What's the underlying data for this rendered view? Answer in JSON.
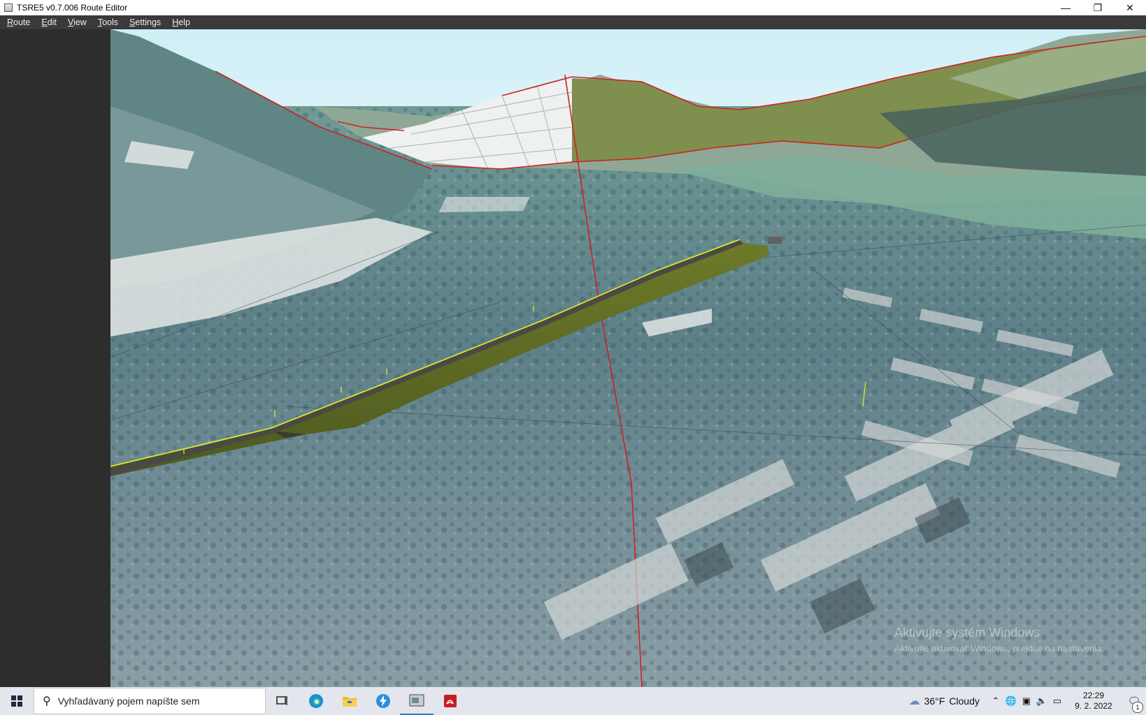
{
  "window": {
    "title": "TSRE5 v0.7.006 Route Editor",
    "minimize_glyph": "—",
    "maximize_glyph": "❐",
    "close_glyph": "✕"
  },
  "menu": {
    "items": [
      "Route",
      "Edit",
      "View",
      "Tools",
      "Settings",
      "Help"
    ]
  },
  "watermark": {
    "line1": "Aktivujte systém Windows",
    "line2": "Aktivujte aktivovať Windows, prejdite na nastavenia."
  },
  "taskbar": {
    "search_placeholder": "Vyhľadávaný pojem napíšte sem",
    "weather_temp": "36°F",
    "weather_text": "Cloudy",
    "time": "22:29",
    "date": "9. 2. 2022",
    "notification_count": "1"
  },
  "colors": {
    "menubar_bg": "#3a3a3a",
    "panel_bg": "#2d2d2d",
    "terrain_outline": "#d02020",
    "track_highlight": "#e6f020"
  }
}
